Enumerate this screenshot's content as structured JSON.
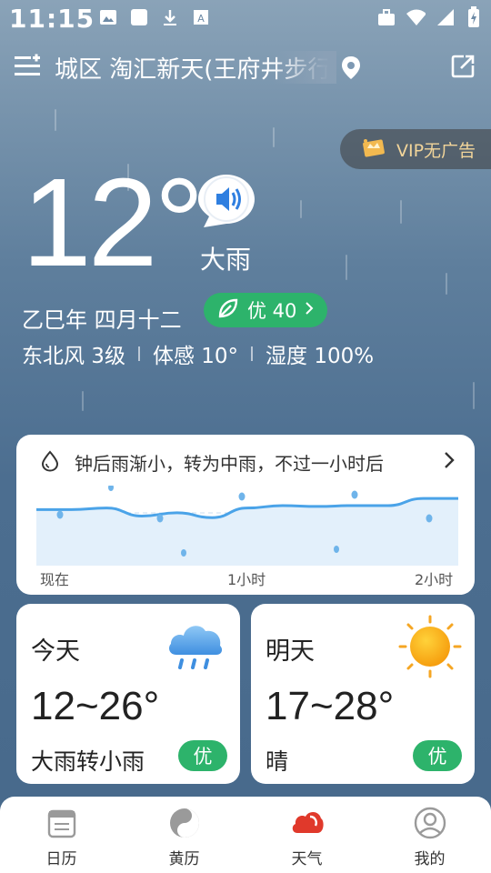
{
  "status_bar": {
    "time": "11:15",
    "left_icons": [
      "image-icon",
      "square-icon",
      "download-icon",
      "text-icon"
    ],
    "right_icons": [
      "briefcase-icon",
      "wifi-icon",
      "signal-icon",
      "battery-charging-icon"
    ]
  },
  "header": {
    "location": "城区 淘汇新天(王府井步行街)",
    "menu_icon": "menu-add-icon",
    "share_icon": "share-icon"
  },
  "vip": {
    "label": "VIP无广告"
  },
  "current": {
    "temperature": "12°",
    "condition": "大雨",
    "lunar_date": "乙巳年 四月十二",
    "aqi": "优 40",
    "wind": "东北风 3级",
    "feels_like": "体感 10°",
    "humidity": "湿度 100%"
  },
  "rain_forecast": {
    "message": "钟后雨渐小，转为中雨，不过一小时后",
    "labels": [
      "现在",
      "1小时",
      "2小时"
    ]
  },
  "chart_data": {
    "type": "area",
    "x": [
      0,
      10,
      20,
      30,
      40,
      50,
      60,
      70,
      80,
      90,
      100,
      110,
      120
    ],
    "series": [
      {
        "values": [
          0.7,
          0.7,
          0.72,
          0.62,
          0.66,
          0.6,
          0.72,
          0.75,
          0.74,
          0.75,
          0.75,
          0.84,
          0.84
        ]
      }
    ],
    "ylim": [
      0,
      1
    ]
  },
  "today": {
    "name": "今天",
    "range": "12~26°",
    "condition": "大雨转小雨",
    "aqi": "优"
  },
  "tomorrow": {
    "name": "明天",
    "range": "17~28°",
    "condition": "晴",
    "aqi": "优"
  },
  "nav": [
    {
      "label": "日历",
      "icon": "calendar-icon"
    },
    {
      "label": "黄历",
      "icon": "yin-yang-icon"
    },
    {
      "label": "天气",
      "icon": "weather-icon",
      "active": true
    },
    {
      "label": "我的",
      "icon": "profile-icon"
    }
  ],
  "colors": {
    "accent_green": "#2db36b",
    "active_red": "#e0392b",
    "rain_blue": "#4aa3e8"
  }
}
